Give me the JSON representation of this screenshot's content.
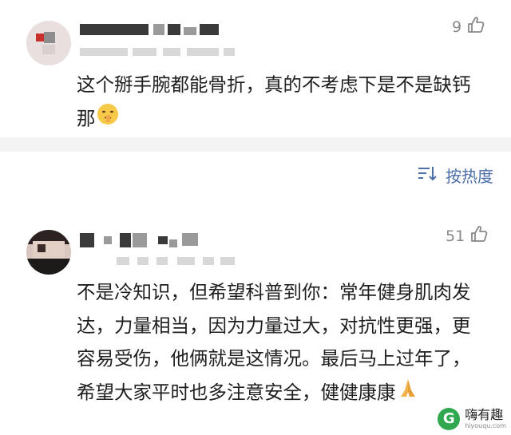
{
  "comments": [
    {
      "likes": "9",
      "text": "这个掰手腕都能骨折，真的不考虑下是不是缺钙那",
      "emoji": "shushing-face"
    },
    {
      "likes": "51",
      "text": "不是冷知识，但希望科普到你：常年健身肌肉发达，力量相当，因为力量过大，对抗性更强，更容易受伤，他俩就是这情况。最后马上过年了，希望大家平时也多注意安全，健健康康",
      "emoji": "folded-hands"
    }
  ],
  "sort": {
    "label": "按热度",
    "icon": "sort-icon"
  },
  "watermark": {
    "name": "嗨有趣",
    "url": "hiyouqu.com"
  },
  "colors": {
    "accent": "#4b6ea8",
    "divider": "#f3f3f3",
    "likes": "#888888"
  }
}
